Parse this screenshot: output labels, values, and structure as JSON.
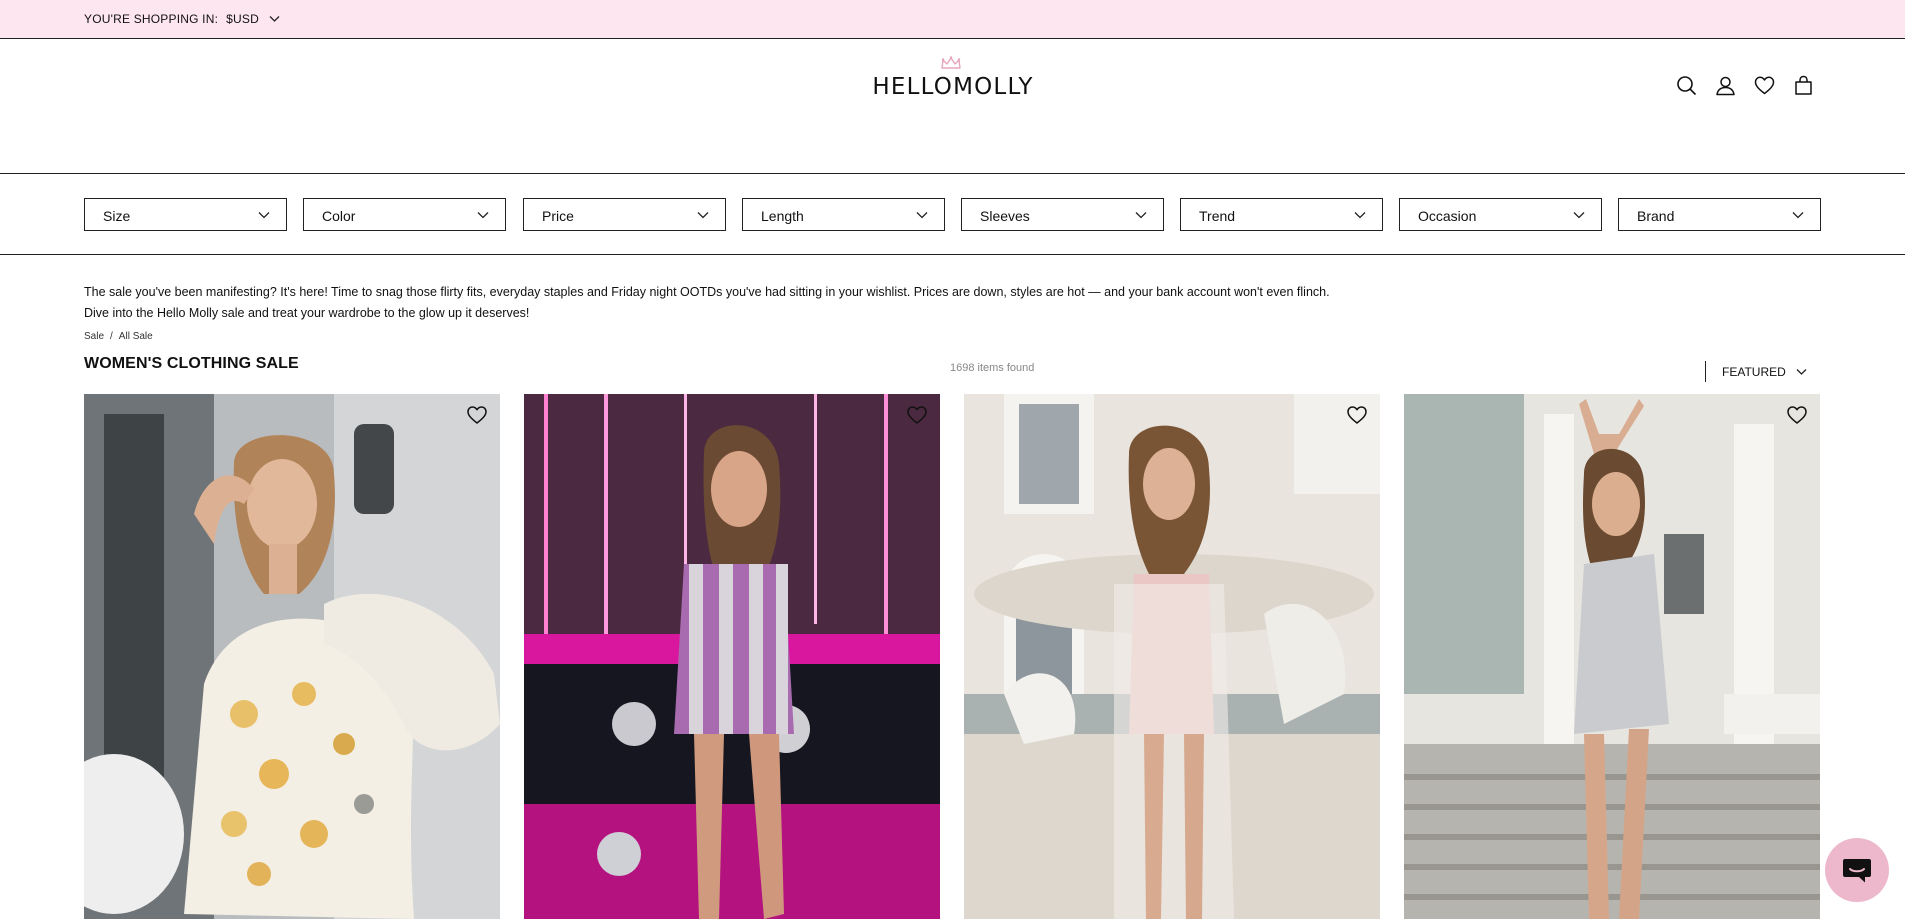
{
  "topbar": {
    "shopping_label": "YOU'RE SHOPPING IN:",
    "currency": "$USD",
    "background": "#fde6f0"
  },
  "header": {
    "logo_text": "HELLOMOLLY",
    "icons": [
      "search-icon",
      "account-icon",
      "wishlist-icon",
      "bag-icon"
    ]
  },
  "filters": [
    {
      "label": "Size"
    },
    {
      "label": "Color"
    },
    {
      "label": "Price"
    },
    {
      "label": "Length"
    },
    {
      "label": "Sleeves"
    },
    {
      "label": "Trend"
    },
    {
      "label": "Occasion"
    },
    {
      "label": "Brand"
    }
  ],
  "intro": {
    "line1": "The sale you've been manifesting? It's here! Time to snag those flirty fits, everyday staples and Friday night OOTDs you've had sitting in your wishlist. Prices are down, styles are hot — and your bank account won't even flinch.",
    "line2": "Dive into the Hello Molly sale and treat your wardrobe to the glow up it deserves!"
  },
  "breadcrumb": {
    "items": [
      "Sale",
      "All Sale"
    ],
    "separator": "/"
  },
  "listing": {
    "title": "WOMEN'S CLOTHING SALE",
    "count": "1698 items found",
    "sort_label": "FEATURED"
  },
  "products": [
    {
      "image": "model in white floral one-shoulder dress"
    },
    {
      "image": "model in pink and silver striped sequin mini dress"
    },
    {
      "image": "model in blush strapless mini dress with fringe"
    },
    {
      "image": "model in silver sequin one-shoulder mini dress"
    }
  ],
  "colors": {
    "accent_pink": "#e6a6bd",
    "chat_button": "#eeb8cc",
    "text": "#111111"
  }
}
